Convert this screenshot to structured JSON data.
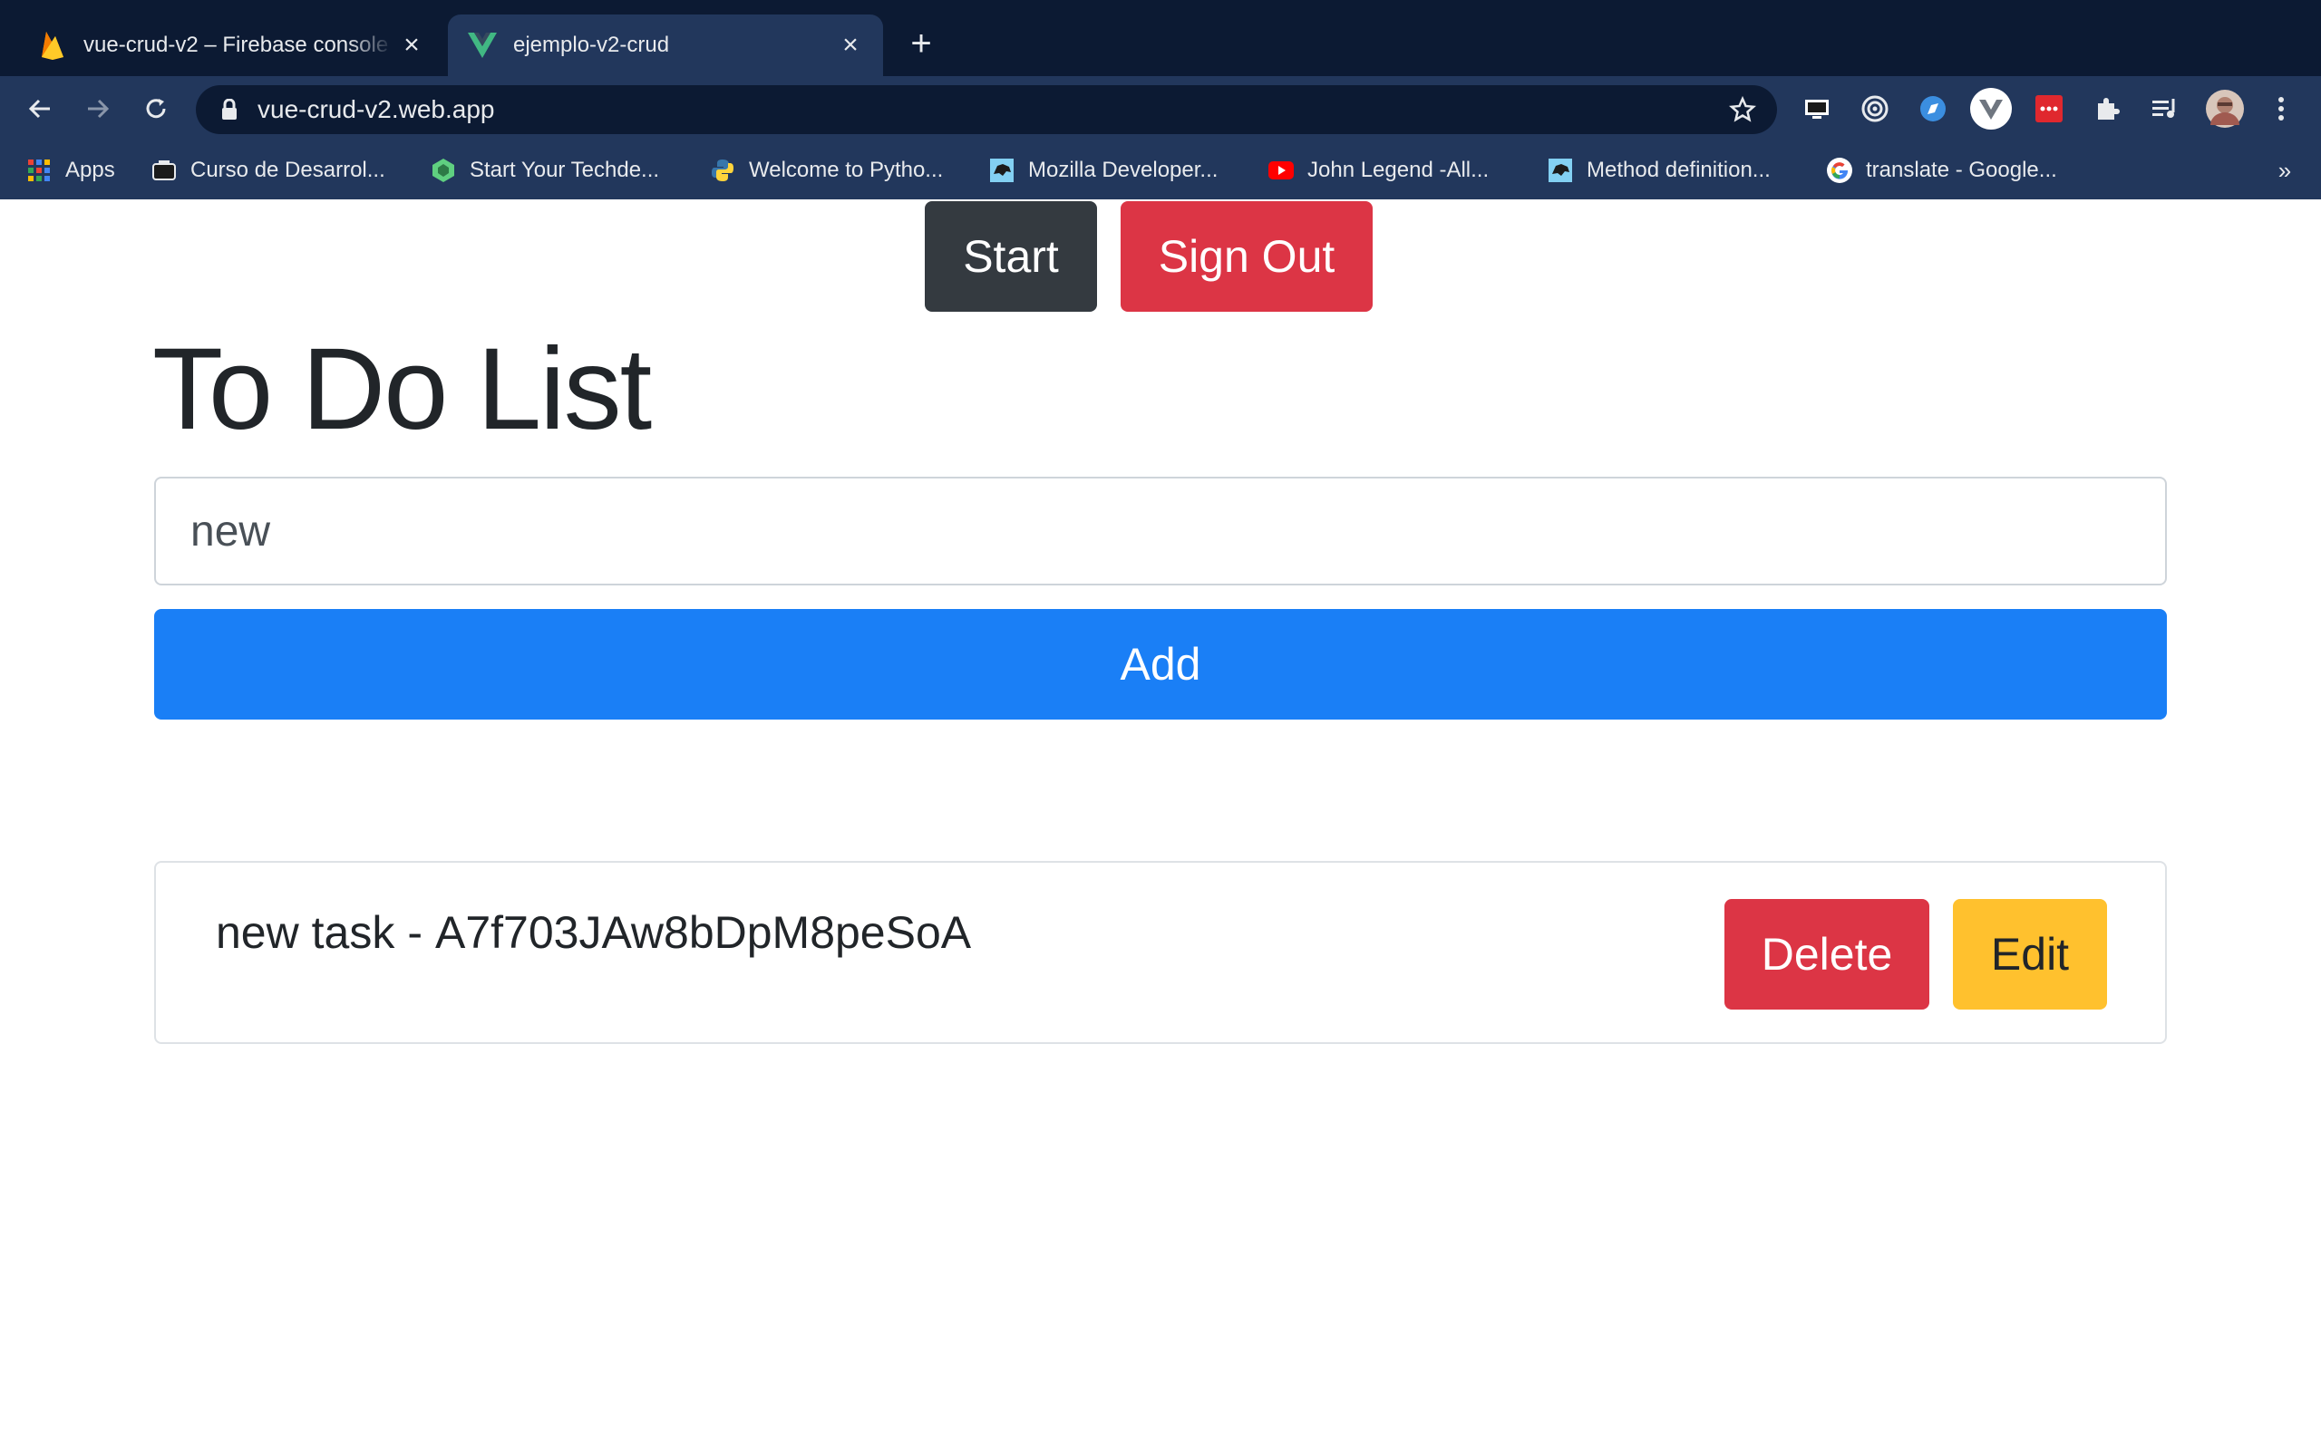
{
  "browser": {
    "tabs": [
      {
        "title": "vue-crud-v2 – Firebase console",
        "favicon": "firebase-icon",
        "active": false
      },
      {
        "title": "ejemplo-v2-crud",
        "favicon": "vue-icon",
        "active": true
      }
    ],
    "url": "vue-crud-v2.web.app",
    "bookmarks": [
      {
        "label": "Apps",
        "icon": "apps-grid-icon"
      },
      {
        "label": "Curso de Desarrol...",
        "icon": "course-icon"
      },
      {
        "label": "Start Your Techde...",
        "icon": "techdegree-icon"
      },
      {
        "label": "Welcome to Pytho...",
        "icon": "python-icon"
      },
      {
        "label": "Mozilla Developer...",
        "icon": "mdn-icon"
      },
      {
        "label": "John Legend -All...",
        "icon": "youtube-icon"
      },
      {
        "label": "Method definition...",
        "icon": "mdn-icon"
      },
      {
        "label": "translate - Google...",
        "icon": "google-icon"
      }
    ],
    "colors": {
      "tabbar": "#0c1a33",
      "toolbar": "#22375c",
      "text": "#e8eaed"
    }
  },
  "header": {
    "start_label": "Start",
    "signout_label": "Sign Out"
  },
  "main": {
    "title": "To Do List",
    "input_value": "new",
    "add_label": "Add"
  },
  "tasks": [
    {
      "name": "new task",
      "separator": "-",
      "id": "A7f703JAw8bDpM8peSoA",
      "delete_label": "Delete",
      "edit_label": "Edit"
    }
  ],
  "colors": {
    "dark": "#343a40",
    "danger": "#dc3545",
    "primary": "#1a7ff6",
    "warning": "#ffc12e"
  }
}
